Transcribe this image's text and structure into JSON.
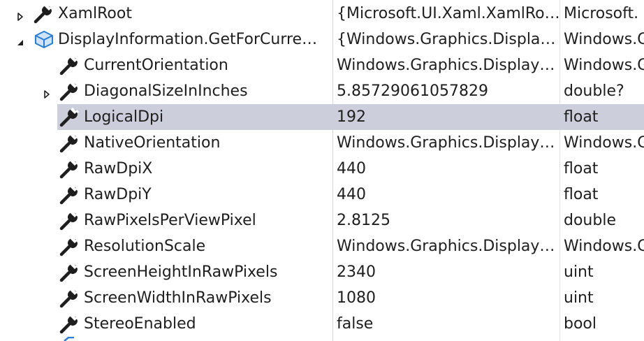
{
  "colors": {
    "selection": "#cccedb",
    "text": "#1e1e1e",
    "gridline": "#d6d6d6",
    "wrench": "#1e1e1e",
    "object_icon": "#2a7ed3"
  },
  "rows": [
    {
      "name": "XamlRoot",
      "value": "{Microsoft.UI.Xaml.XamlRo…",
      "type": "Microsoft.",
      "icon": "wrench-icon",
      "expander": "collapsed"
    },
    {
      "name": "DisplayInformation.GetForCurre…",
      "value": "{Windows.Graphics.Displa…",
      "type": "Windows.G",
      "icon": "object-icon",
      "expander": "expanded"
    },
    {
      "name": "CurrentOrientation",
      "value": "Windows.Graphics.Display…",
      "type": "Windows.G",
      "icon": "wrench-icon",
      "expander": "none"
    },
    {
      "name": "DiagonalSizeInInches",
      "value": "5.85729061057829",
      "type": "double?",
      "icon": "wrench-icon",
      "expander": "collapsed"
    },
    {
      "name": "LogicalDpi",
      "value": "192",
      "type": "float",
      "icon": "wrench-icon",
      "expander": "none",
      "selected": true
    },
    {
      "name": "NativeOrientation",
      "value": "Windows.Graphics.Display…",
      "type": "Windows.G",
      "icon": "wrench-icon",
      "expander": "none"
    },
    {
      "name": "RawDpiX",
      "value": "440",
      "type": "float",
      "icon": "wrench-icon",
      "expander": "none"
    },
    {
      "name": "RawDpiY",
      "value": "440",
      "type": "float",
      "icon": "wrench-icon",
      "expander": "none"
    },
    {
      "name": "RawPixelsPerViewPixel",
      "value": "2.8125",
      "type": "double",
      "icon": "wrench-icon",
      "expander": "none"
    },
    {
      "name": "ResolutionScale",
      "value": "Windows.Graphics.Display…",
      "type": "Windows.G",
      "icon": "wrench-icon",
      "expander": "none"
    },
    {
      "name": "ScreenHeightInRawPixels",
      "value": "2340",
      "type": "uint",
      "icon": "wrench-icon",
      "expander": "none"
    },
    {
      "name": "ScreenWidthInRawPixels",
      "value": "1080",
      "type": "uint",
      "icon": "wrench-icon",
      "expander": "none"
    },
    {
      "name": "StereoEnabled",
      "value": "false",
      "type": "bool",
      "icon": "wrench-icon",
      "expander": "none"
    }
  ]
}
